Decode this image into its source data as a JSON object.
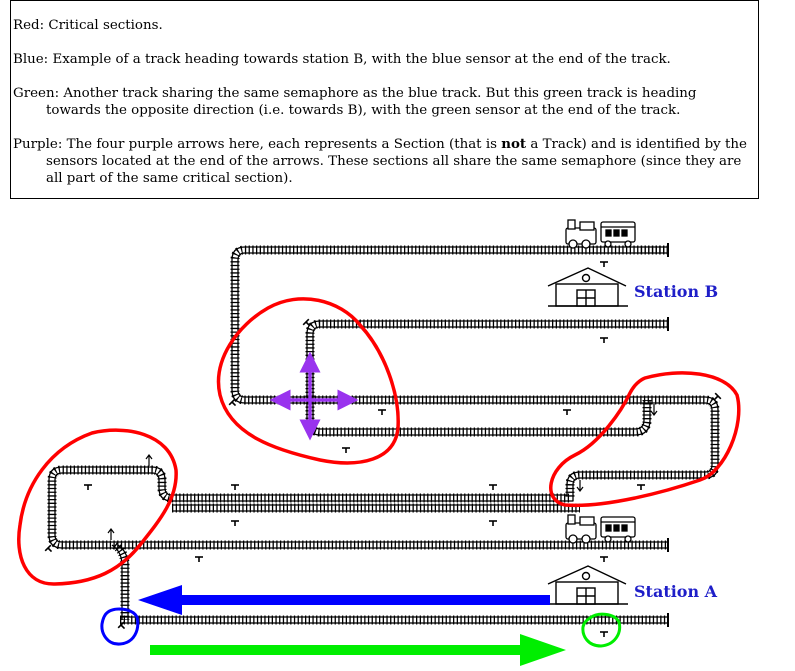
{
  "legend": {
    "red": {
      "key": "Red:",
      "text": "Critical sections."
    },
    "blue": {
      "key": "Blue:",
      "text": "Example of a track heading towards station B, with the blue sensor at the end of the track."
    },
    "green": {
      "key": "Green:",
      "text": "Another track sharing the same semaphore as the blue track. But this green track is heading towards the opposite direction (i.e. towards B), with the green sensor at the end of the track."
    },
    "purple": {
      "key": "Purple:",
      "text_before": "The four purple arrows here, each represents a Section (that is ",
      "emphasis": "not",
      "text_after": " a Track) and is identified by the sensors located at the end of the arrows. These sections all share the same semaphore (since they are all part of the same critical section)."
    }
  },
  "stations": {
    "b": {
      "label": "Station B"
    },
    "a": {
      "label": "Station A"
    }
  },
  "colors": {
    "critical_section": "#ff0000",
    "blue_track": "#0000ff",
    "green_track": "#00ee00",
    "section_arrows": "#9933ee",
    "station_label": "#1e1ec8"
  },
  "icons": [
    "train-icon",
    "station-building-icon",
    "sensor-icon"
  ]
}
